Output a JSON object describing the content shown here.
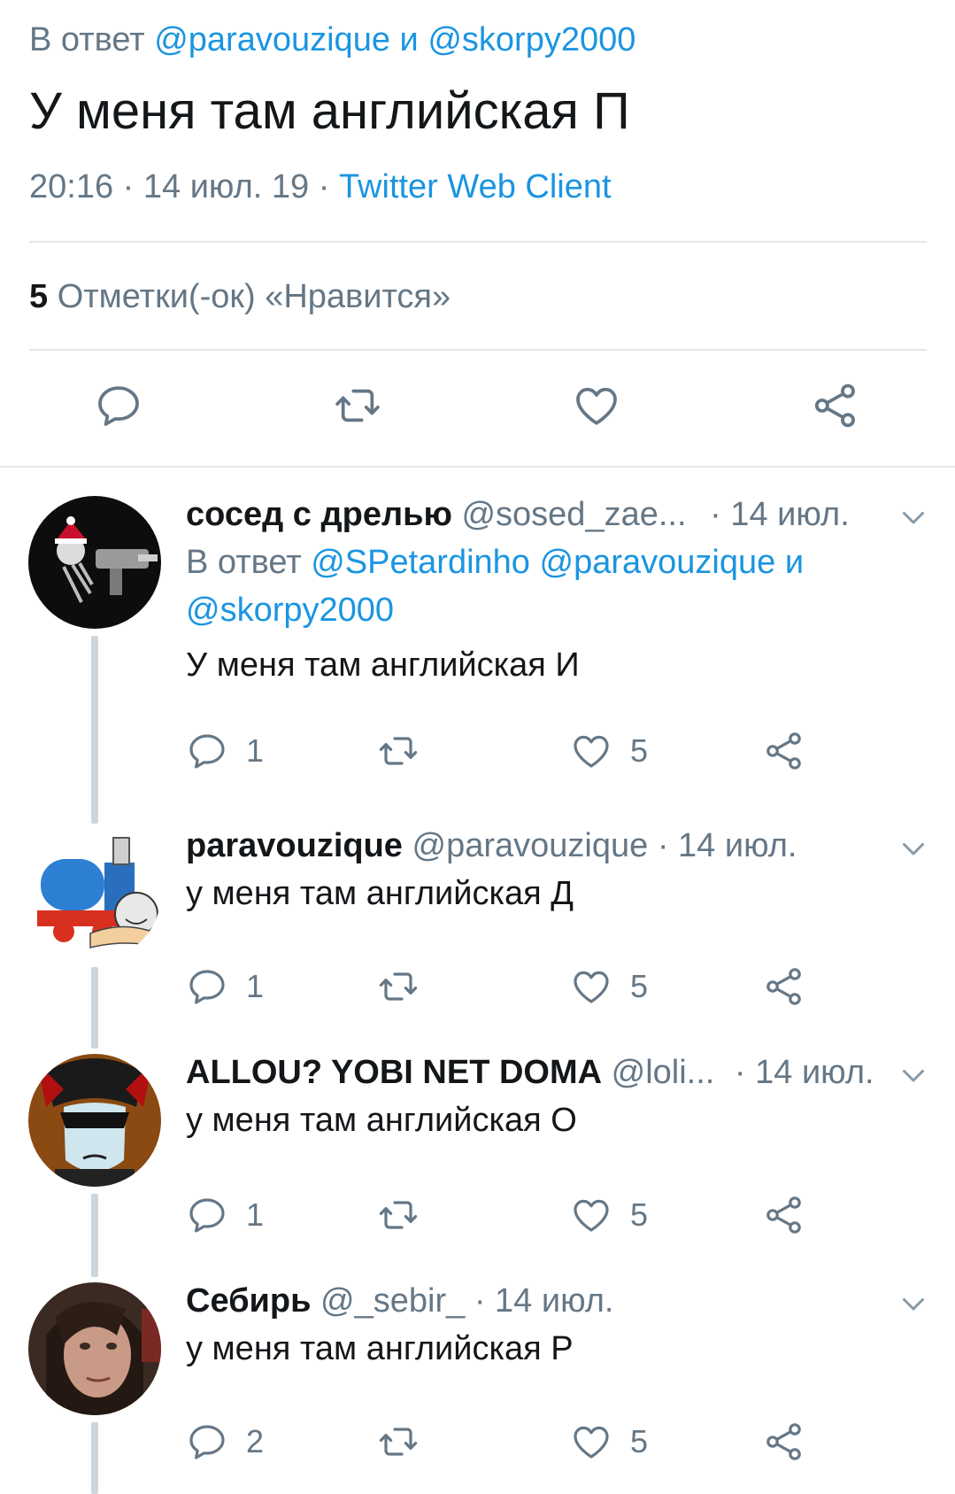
{
  "main_tweet": {
    "reply_prefix": "В ответ",
    "reply_user1": "@paravouzique",
    "reply_conj": "и",
    "reply_user2": "@skorpy2000",
    "text": "У меня там английская П",
    "time": "20:16",
    "sep1": "·",
    "date": "14 июл. 19",
    "sep2": "·",
    "client": "Twitter Web Client",
    "likes_count": "5",
    "likes_label": "Отметки(-ок) «Нравится»"
  },
  "colors": {
    "link": "#1b95e0",
    "secondary": "#657786",
    "primary": "#14171a",
    "divider": "#e1e8ed",
    "thread_line": "#ccd6dd"
  },
  "icons": [
    "reply-icon",
    "retweet-icon",
    "like-icon",
    "share-icon",
    "chevron-down-icon"
  ],
  "replies": [
    {
      "name": "сосед с дрелью",
      "handle": "@sosed_zae...",
      "date": "· 14 июл.",
      "reply_prefix": "В ответ",
      "reply_users": "@SPetardinho @paravouzique",
      "reply_conj": "и",
      "reply_last": "@skorpy2000",
      "text": "У меня там английская И",
      "reply_count": "1",
      "retweet_count": "",
      "like_count": "5"
    },
    {
      "name": "paravouzique",
      "handle": "@paravouzique",
      "date": "· 14 июл.",
      "text": "у меня там английская Д",
      "reply_count": "1",
      "retweet_count": "",
      "like_count": "5"
    },
    {
      "name": "ALLOU? YOBI NET DOMA",
      "handle": "@loli...",
      "date": "· 14 июл.",
      "text": "у меня там английская О",
      "reply_count": "1",
      "retweet_count": "",
      "like_count": "5"
    },
    {
      "name": "Себирь",
      "handle": "@_sebir_",
      "date": "· 14 июл.",
      "text": "у меня там английская Р",
      "reply_count": "2",
      "retweet_count": "",
      "like_count": "5"
    }
  ]
}
